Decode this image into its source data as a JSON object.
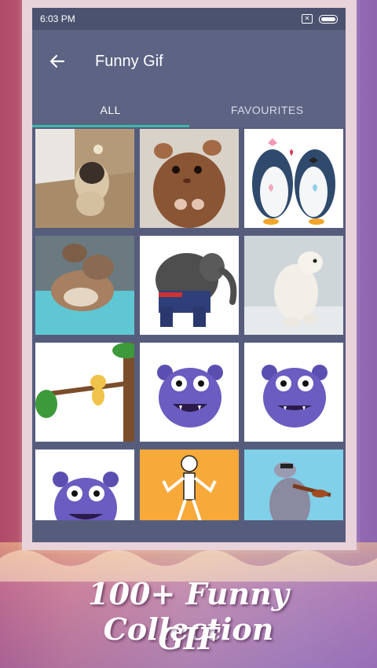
{
  "status_bar": {
    "time": "6:03 PM"
  },
  "app_bar": {
    "title": "Funny Gif"
  },
  "tabs": [
    {
      "label": "ALL",
      "active": true
    },
    {
      "label": "FAVOURITES",
      "active": false
    }
  ],
  "gifs": [
    {
      "subject": "pug dog"
    },
    {
      "subject": "hamster"
    },
    {
      "subject": "penguin couple"
    },
    {
      "subject": "kittens"
    },
    {
      "subject": "elephant in jeans"
    },
    {
      "subject": "polar bear"
    },
    {
      "subject": "cat on branch"
    },
    {
      "subject": "purple monster"
    },
    {
      "subject": "purple monster"
    },
    {
      "subject": "purple monster"
    },
    {
      "subject": "dancing skeleton"
    },
    {
      "subject": "hippo with violin"
    }
  ],
  "promo": {
    "line1": "100+ Funny Collection",
    "line2": "GIF"
  },
  "colors": {
    "app_bar": "#5c6383",
    "tab_indicator": "#3fb8ad",
    "grid_background": "#565d7c"
  }
}
